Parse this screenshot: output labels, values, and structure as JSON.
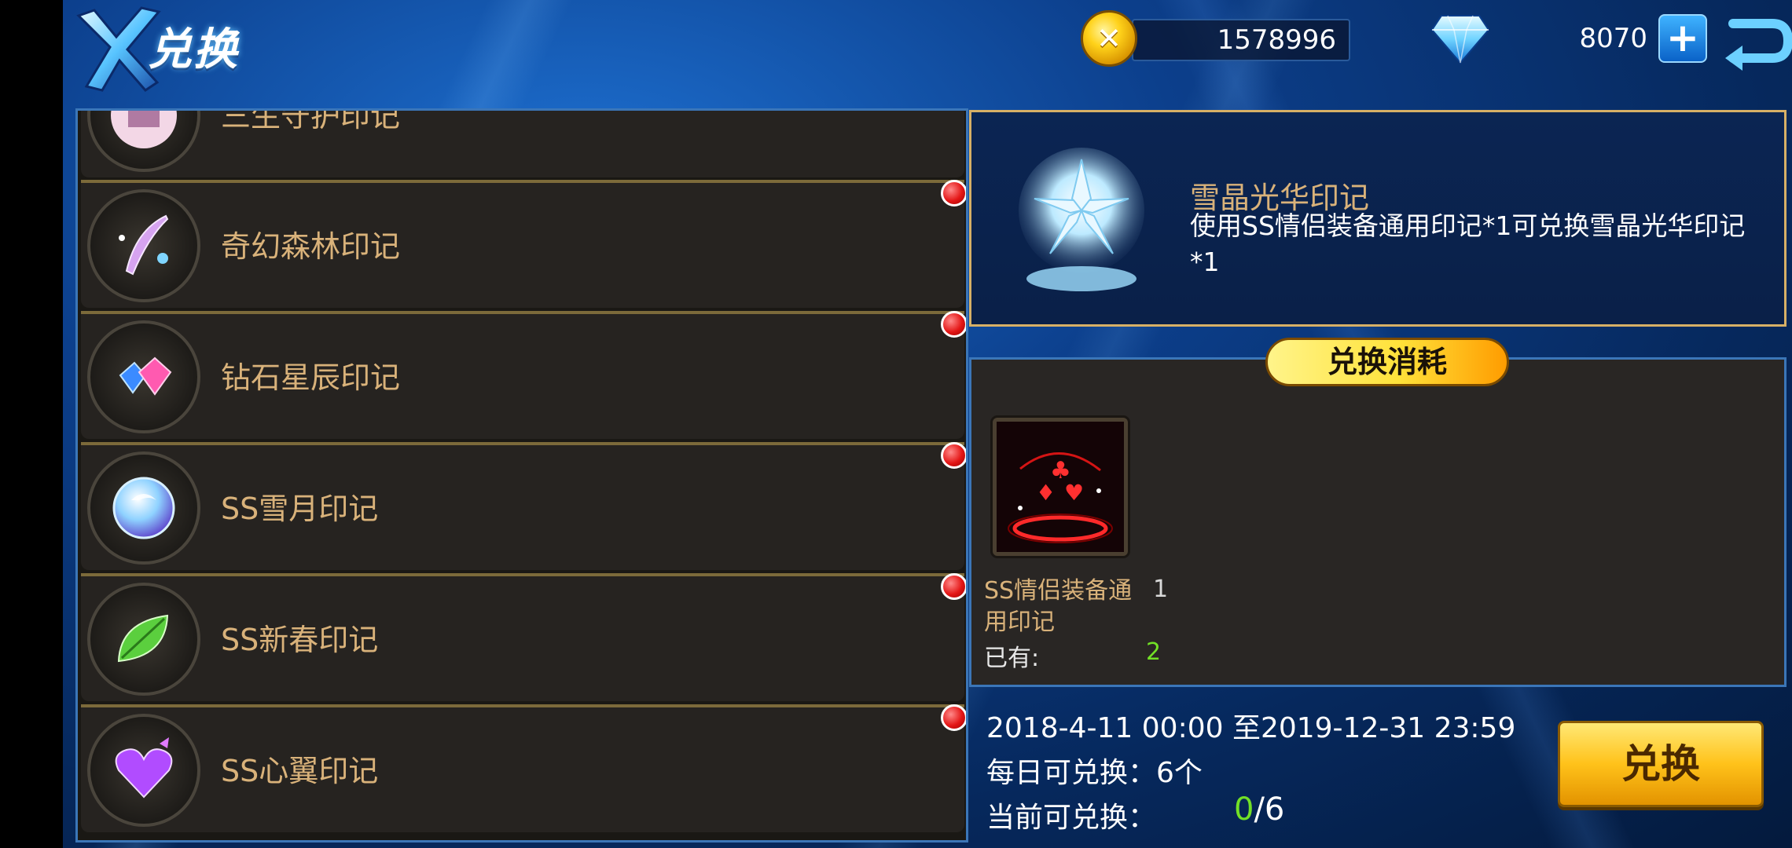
{
  "header": {
    "title": "兑换",
    "gold": "1578996",
    "diamonds": "8070",
    "add_label": "+"
  },
  "list": {
    "items": [
      {
        "label": "三生守护印记",
        "has_dot": false,
        "icon": "lantern-icon"
      },
      {
        "label": "奇幻森林印记",
        "has_dot": true,
        "icon": "feather-icon"
      },
      {
        "label": "钻石星辰印记",
        "has_dot": true,
        "icon": "gem-icon"
      },
      {
        "label": "SS雪月印记",
        "has_dot": true,
        "icon": "moon-orb-icon"
      },
      {
        "label": "SS新春印记",
        "has_dot": true,
        "icon": "leaf-icon"
      },
      {
        "label": "SS心翼印记",
        "has_dot": true,
        "icon": "winged-heart-icon"
      }
    ]
  },
  "detail": {
    "name": "雪晶光华印记",
    "description": "使用SS情侣装备通用印记*1可兑换雪晶光华印记*1"
  },
  "cost": {
    "header": "兑换消耗",
    "item_name": "SS情侣装备通用印记",
    "count": "1",
    "owned_label": "已有:",
    "owned_count": "2"
  },
  "exchange": {
    "date_range": "2018-4-11 00:00 至2019-12-31 23:59",
    "daily_limit": "每日可兑换：6个",
    "current_label": "当前可兑换：",
    "current_value": "0",
    "current_max": "/6",
    "button_label": "兑换"
  },
  "colors": {
    "accent_gold": "#d9b27a",
    "notify_red": "#e41616",
    "positive_green": "#72e026"
  }
}
